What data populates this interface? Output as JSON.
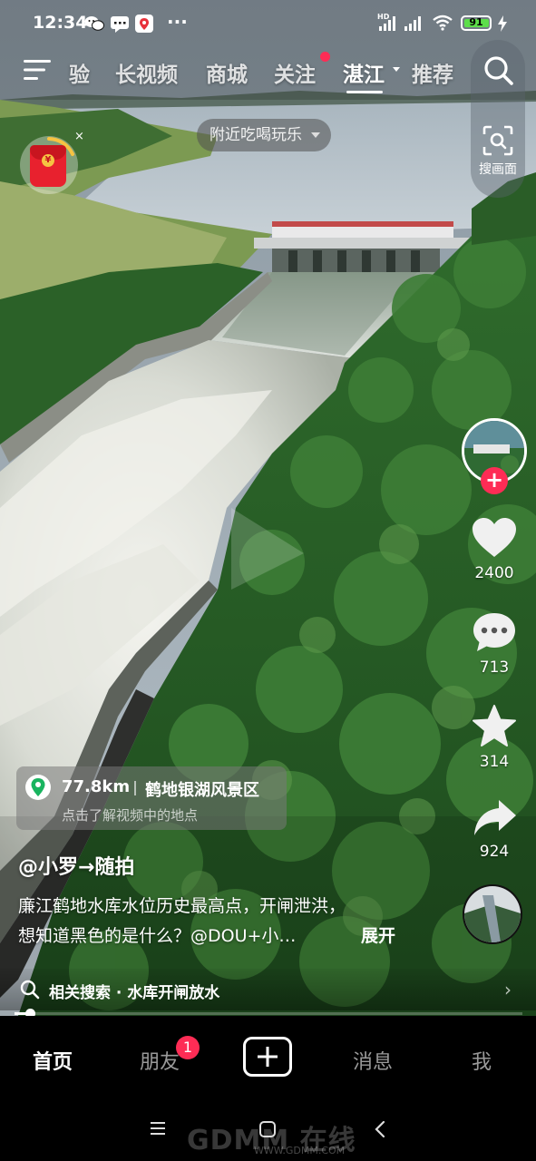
{
  "status_bar": {
    "time": "12:34",
    "dots": "···",
    "hd": "HD",
    "battery": "91",
    "battery_level": 0.91
  },
  "top_nav": {
    "tabs": [
      {
        "label": "验",
        "active": false
      },
      {
        "label": "长视频",
        "active": false
      },
      {
        "label": "商城",
        "active": false
      },
      {
        "label": "关注",
        "active": false,
        "dot": true
      },
      {
        "label": "湛江",
        "active": true,
        "dropdown": true
      },
      {
        "label": "推荐",
        "active": false
      }
    ],
    "search_icon": "search-icon",
    "menu_icon": "hamburger-menu-icon"
  },
  "scan": {
    "label": "搜画面",
    "icon": "scan-icon"
  },
  "location_chip": {
    "label": "附近吃喝玩乐"
  },
  "red_packet": {
    "icon": "red-packet-icon",
    "close": "×"
  },
  "right_rail": {
    "follow": "+",
    "likes": "2400",
    "comments": "713",
    "favorites": "314",
    "shares": "924"
  },
  "poi": {
    "distance": "77.8km",
    "name": "鹤地银湖风景区",
    "hint": "点击了解视频中的地点"
  },
  "video": {
    "author": "@小罗→随拍",
    "desc_line1": "廉江鹤地水库水位历史最高点，开闸泄洪，",
    "desc_line2": "想知道黑色的是什么？@DOU+小…",
    "expand": "展开",
    "progress": 0.03
  },
  "related": {
    "prefix": "相关搜索",
    "dot": "·",
    "query": "水库开闸放水",
    "chevron": "›"
  },
  "tab_bar": {
    "home": "首页",
    "friends": "朋友",
    "friends_badge": "1",
    "messages": "消息",
    "me": "我"
  },
  "watermark": {
    "big": "GDMM 在线",
    "small": "WWW.GDMM.COM"
  },
  "colors": {
    "accent": "#fe2c55",
    "battery": "#5dde4a"
  }
}
